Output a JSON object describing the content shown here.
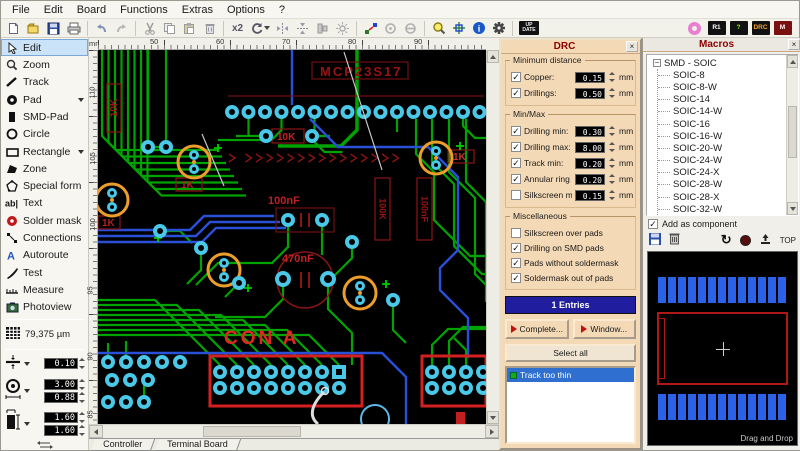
{
  "menu": {
    "items": [
      "File",
      "Edit",
      "Board",
      "Functions",
      "Extras",
      "Options",
      "?"
    ]
  },
  "toolbar": {
    "duplicate_label": "x2",
    "update_label": "UP DATE",
    "badges": {
      "r1": "R1",
      "help": "?",
      "drc": "DRC",
      "hotkey": "M"
    }
  },
  "sidebar": {
    "tools": [
      {
        "label": "Edit"
      },
      {
        "label": "Zoom"
      },
      {
        "label": "Track"
      },
      {
        "label": "Pad"
      },
      {
        "label": "SMD-Pad"
      },
      {
        "label": "Circle"
      },
      {
        "label": "Rectangle"
      },
      {
        "label": "Zone"
      },
      {
        "label": "Special form"
      },
      {
        "label": "Text"
      },
      {
        "label": "Solder mask"
      },
      {
        "label": "Connections"
      },
      {
        "label": "Autoroute"
      },
      {
        "label": "Test"
      },
      {
        "label": "Measure"
      },
      {
        "label": "Photoview"
      }
    ],
    "grid_label": "79,375 µm",
    "fields": {
      "track": "0.10",
      "pad_outer": "3.00",
      "pad_drill": "0.88",
      "smd_w": "1.60",
      "smd_h": "1.60"
    }
  },
  "canvas": {
    "unit": "mm",
    "ruler_h": [
      "50",
      "60",
      "70",
      "80",
      "90"
    ],
    "ruler_v": [
      "110",
      "105",
      "100",
      "95",
      "90",
      "85"
    ],
    "labels": {
      "chip": "MCP23S17",
      "cap1": "100nF",
      "cap2": "470nF",
      "con": "CON A",
      "r1k_a": "1K",
      "r1k_b": "1K",
      "r1k_c": "1K",
      "r10k_a": "10K",
      "r10k_b": "10K",
      "r100k": "100K",
      "c100n": "100nF"
    }
  },
  "tabs": {
    "items": [
      "Controller",
      "Terminal Board"
    ]
  },
  "drc": {
    "title": "DRC",
    "groups": [
      {
        "title": "Minimum distance",
        "rows": [
          {
            "check": "✓",
            "label": "Copper:",
            "value": "0.15",
            "unit": "mm"
          },
          {
            "check": "✓",
            "label": "Drillings:",
            "value": "0.50",
            "unit": "mm"
          }
        ]
      },
      {
        "title": "Min/Max",
        "rows": [
          {
            "check": "✓",
            "label": "Drilling min:",
            "value": "0.30",
            "unit": "mm"
          },
          {
            "check": "✓",
            "label": "Drilling max:",
            "value": "8.00",
            "unit": "mm"
          },
          {
            "check": "✓",
            "label": "Track min:",
            "value": "0.20",
            "unit": "mm"
          },
          {
            "check": "✓",
            "label": "Annular ring min",
            "value": "0.20",
            "unit": "mm"
          },
          {
            "check": "",
            "label": "Silkscreen min:",
            "value": "0.15",
            "unit": "mm"
          }
        ]
      },
      {
        "title": "Miscellaneous",
        "rows": [
          {
            "check": "",
            "label": "Silkscreen over pads"
          },
          {
            "check": "✓",
            "label": "Drilling on SMD pads"
          },
          {
            "check": "✓",
            "label": "Pads without soldermask"
          },
          {
            "check": "✓",
            "label": "Soldermask out of pads"
          }
        ]
      }
    ],
    "entries_label": "1 Entries",
    "complete_button": "Complete...",
    "window_button": "Window...",
    "select_all_button": "Select all",
    "results": [
      {
        "label": "Track too thin"
      }
    ]
  },
  "macros": {
    "title": "Macros",
    "root": "SMD - SOIC",
    "items": [
      "SOIC-8",
      "SOIC-8-W",
      "SOIC-14",
      "SOIC-14-W",
      "SOIC-16",
      "SOIC-16-W",
      "SOIC-20-W",
      "SOIC-24-W",
      "SOIC-24-X",
      "SOIC-28-W",
      "SOIC-28-X",
      "SOIC-32-W"
    ],
    "add_as_component": "Add as component",
    "top_label": "TOP",
    "drag_hint": "Drag and Drop"
  }
}
